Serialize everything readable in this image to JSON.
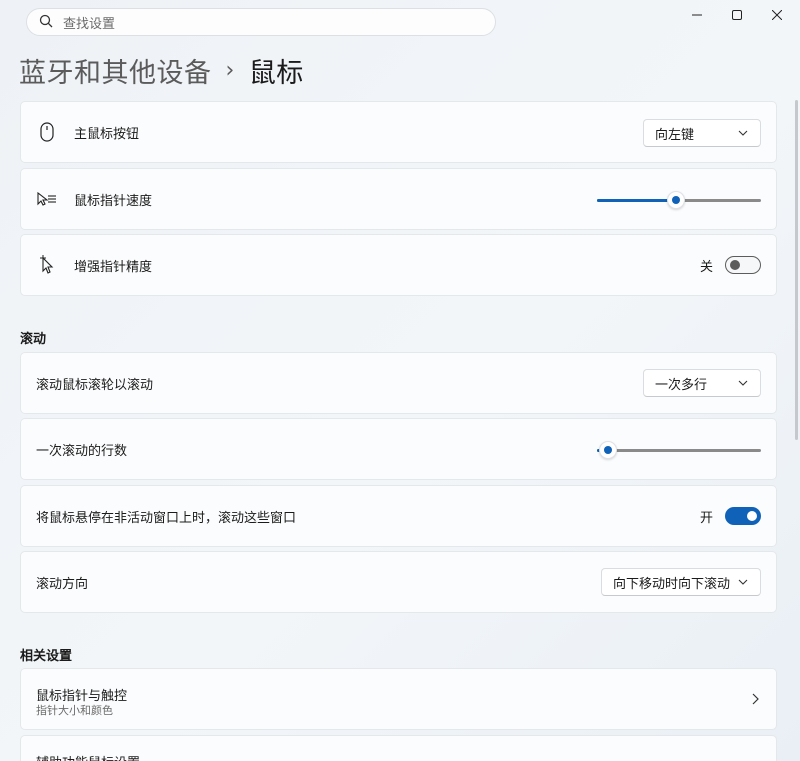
{
  "search": {
    "placeholder": "查找设置"
  },
  "header": {
    "breadcrumb": "蓝牙和其他设备",
    "separator": "›",
    "title": "鼠标"
  },
  "settings": {
    "primary_button": {
      "label": "主鼠标按钮",
      "value": "向左键"
    },
    "pointer_speed": {
      "label": "鼠标指针速度",
      "value_fraction": 0.48
    },
    "precision": {
      "label": "增强指针精度",
      "state_text": "关",
      "on": false
    }
  },
  "scrolling": {
    "section_title": "滚动",
    "roll_mode": {
      "label": "滚动鼠标滚轮以滚动",
      "value": "一次多行"
    },
    "lines": {
      "label": "一次滚动的行数",
      "value_fraction": 0.07
    },
    "inactive": {
      "label": "将鼠标悬停在非活动窗口上时，滚动这些窗口",
      "state_text": "开",
      "on": true
    },
    "direction": {
      "label": "滚动方向",
      "value": "向下移动时向下滚动"
    }
  },
  "related": {
    "section_title": "相关设置",
    "pointer_touch": {
      "label": "鼠标指针与触控",
      "sublabel": "指针大小和颜色"
    },
    "accessibility": {
      "label": "辅助功能鼠标设置"
    }
  },
  "colors": {
    "accent": "#0f62b8"
  },
  "icons": {
    "search": "search-icon",
    "minimize": "minimize-icon",
    "maximize": "maximize-icon",
    "close": "close-icon",
    "mouse": "mouse-icon",
    "pointer_speed": "pointer-speed-icon",
    "precision": "pointer-precision-icon",
    "chevron_down": "chevron-down-icon",
    "chevron_right": "chevron-right-icon"
  }
}
